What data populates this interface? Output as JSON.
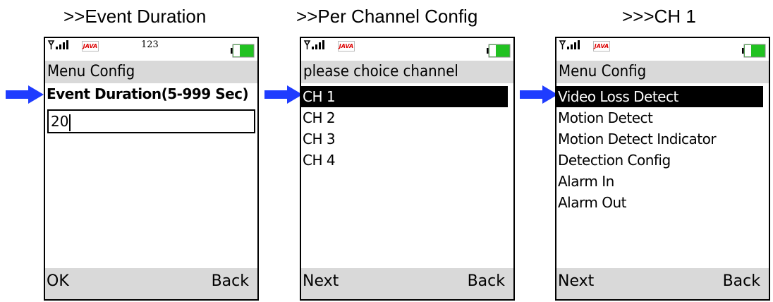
{
  "captions": [
    ">>Event Duration",
    ">>Per Channel Config",
    ">>>CH 1"
  ],
  "phone1": {
    "ticker": "123",
    "java_badge": "JAVA",
    "title": "Menu Config",
    "field_label": "Event Duration(5-999 Sec)",
    "field_value": "20",
    "soft_left": "OK",
    "soft_right": "Back"
  },
  "phone2": {
    "java_badge": "JAVA",
    "title": "please choice channel",
    "items": [
      "CH 1",
      "CH 2",
      "CH 3",
      "CH 4"
    ],
    "selected_index": 0,
    "soft_left": "Next",
    "soft_right": "Back"
  },
  "phone3": {
    "java_badge": "JAVA",
    "title": "Menu Config",
    "items": [
      "Video Loss Detect",
      "Motion Detect",
      "Motion Detect Indicator",
      "Detection Config",
      "Alarm In",
      "Alarm Out"
    ],
    "selected_index": 0,
    "soft_left": "Next",
    "soft_right": "Back"
  },
  "colors": {
    "arrow": "#1f3cff",
    "bar_gray": "#d9d9d9",
    "battery_green": "#22c222",
    "selection": "#000000"
  },
  "icons": [
    "signal-icon",
    "java-icon",
    "battery-icon",
    "pointer-arrow-icon"
  ]
}
